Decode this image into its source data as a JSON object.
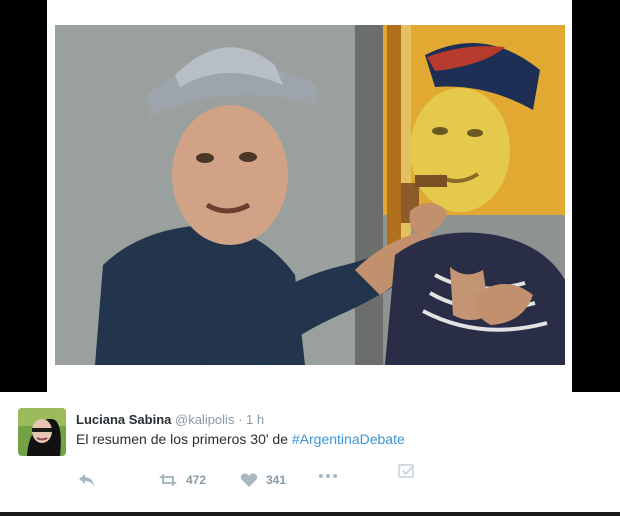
{
  "tweet": {
    "author_name": "Luciana Sabina",
    "handle": "@kalipolis",
    "separator": "·",
    "time": "1 h",
    "text_prefix": "El resumen de los primeros 30' de ",
    "hashtag": "#ArgentinaDebate",
    "retweets": "472",
    "likes": "341"
  },
  "icons": {
    "reply": "reply-icon",
    "retweet": "retweet-icon",
    "like": "heart-icon",
    "more": "more-icon",
    "save": "checkbox-icon"
  },
  "colors": {
    "hashtag": "#3b94d9",
    "muted": "#8899a6",
    "action": "#aab8c2",
    "name": "#292f33"
  }
}
